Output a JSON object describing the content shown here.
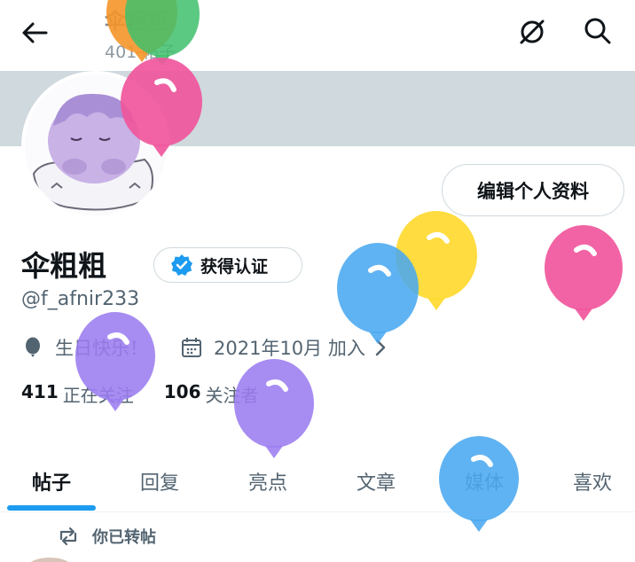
{
  "header": {
    "title": "伞粗粗",
    "subtitle": "401 帖子",
    "back_icon": "arrow-left-icon",
    "grok_icon": "grok-icon",
    "search_icon": "search-icon"
  },
  "profile": {
    "edit_button": "编辑个人资料",
    "display_name": "伞粗粗",
    "verify_label": "获得认证",
    "handle": "@f_afnir233",
    "birthday": "生日快乐！",
    "joined": "2021年10月 加入",
    "following_count": "411",
    "following_label": "正在关注",
    "followers_count": "106",
    "followers_label": "关注者"
  },
  "tabs": [
    {
      "label": "帖子",
      "active": true
    },
    {
      "label": "回复",
      "active": false
    },
    {
      "label": "亮点",
      "active": false
    },
    {
      "label": "文章",
      "active": false
    },
    {
      "label": "媒体",
      "active": false
    },
    {
      "label": "喜欢",
      "active": false
    }
  ],
  "feed": {
    "repost_label": "你已转帖"
  },
  "colors": {
    "accent": "#1d9bf0",
    "banner": "#cfd9de",
    "balloon_orange": "#f5952a",
    "balloon_green": "#3fbf6c",
    "balloon_pink": "#f0569c",
    "balloon_blue": "#4aa8f0",
    "balloon_yellow": "#ffd92f",
    "balloon_purple": "#9b7cf0"
  }
}
